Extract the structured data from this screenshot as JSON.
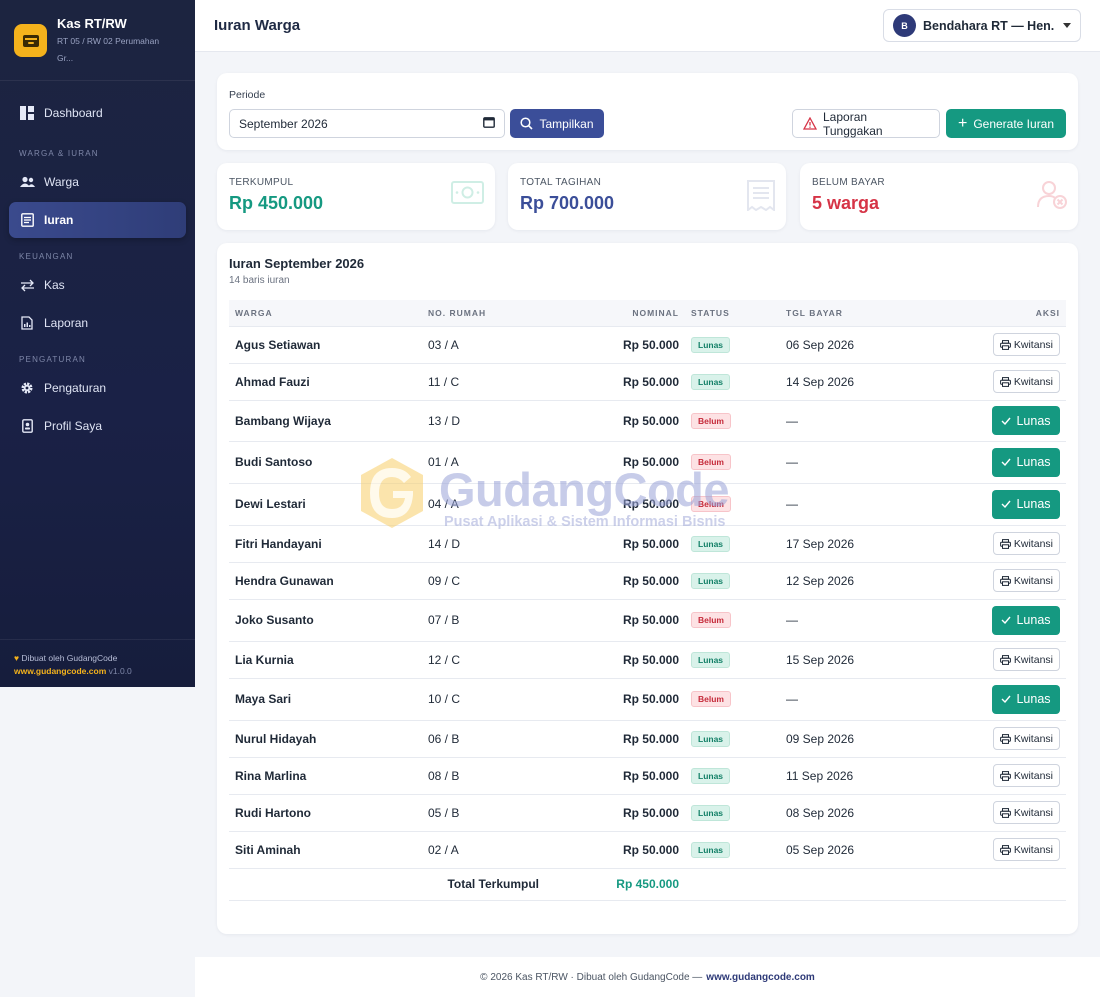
{
  "sidebar": {
    "brand_title": "Kas RT/RW",
    "brand_sub": "RT 05 / RW 02 Perumahan Gr...",
    "dashboard": "Dashboard",
    "section_warga": "WARGA & IURAN",
    "warga": "Warga",
    "iuran": "Iuran",
    "section_keuangan": "KEUANGAN",
    "kas": "Kas",
    "laporan": "Laporan",
    "section_pengaturan": "PENGATURAN",
    "pengaturan": "Pengaturan",
    "profil": "Profil Saya",
    "foot_made": "Dibuat oleh GudangCode",
    "foot_link": "www.gudangcode.com",
    "foot_version": "v1.0.0"
  },
  "header": {
    "title": "Iuran Warga",
    "user_initial": "B",
    "user_name": "Bendahara RT — Hen..."
  },
  "filter": {
    "label": "Periode",
    "value": "September 2026",
    "tampilkan": "Tampilkan",
    "laporan_tunggakan": "Laporan Tunggakan",
    "generate": "Generate Iuran"
  },
  "stats": {
    "terkumpul_label": "TERKUMPUL",
    "terkumpul_value": "Rp 450.000",
    "tagihan_label": "TOTAL TAGIHAN",
    "tagihan_value": "Rp 700.000",
    "belum_label": "BELUM BAYAR",
    "belum_value": "5 warga"
  },
  "colors": {
    "accent": "#159981",
    "primary": "#3b4e99",
    "danger": "#d63447",
    "brand": "#f4b21c"
  },
  "table": {
    "title": "Iuran September 2026",
    "subtitle": "14 baris iuran",
    "headers": [
      "WARGA",
      "NO. RUMAH",
      "NOMINAL",
      "STATUS",
      "TGL BAYAR",
      "AKSI"
    ],
    "rows": [
      {
        "warga": "Agus Setiawan",
        "rumah": "03 / A",
        "nominal": "Rp 50.000",
        "status": "Lunas",
        "tgl": "06 Sep 2026",
        "aksi": "Kwitansi"
      },
      {
        "warga": "Ahmad Fauzi",
        "rumah": "11 / C",
        "nominal": "Rp 50.000",
        "status": "Lunas",
        "tgl": "14 Sep 2026",
        "aksi": "Kwitansi"
      },
      {
        "warga": "Bambang Wijaya",
        "rumah": "13 / D",
        "nominal": "Rp 50.000",
        "status": "Belum",
        "tgl": "—",
        "aksi": "Lunas"
      },
      {
        "warga": "Budi Santoso",
        "rumah": "01 / A",
        "nominal": "Rp 50.000",
        "status": "Belum",
        "tgl": "—",
        "aksi": "Lunas"
      },
      {
        "warga": "Dewi Lestari",
        "rumah": "04 / A",
        "nominal": "Rp 50.000",
        "status": "Belum",
        "tgl": "—",
        "aksi": "Lunas"
      },
      {
        "warga": "Fitri Handayani",
        "rumah": "14 / D",
        "nominal": "Rp 50.000",
        "status": "Lunas",
        "tgl": "17 Sep 2026",
        "aksi": "Kwitansi"
      },
      {
        "warga": "Hendra Gunawan",
        "rumah": "09 / C",
        "nominal": "Rp 50.000",
        "status": "Lunas",
        "tgl": "12 Sep 2026",
        "aksi": "Kwitansi"
      },
      {
        "warga": "Joko Susanto",
        "rumah": "07 / B",
        "nominal": "Rp 50.000",
        "status": "Belum",
        "tgl": "—",
        "aksi": "Lunas"
      },
      {
        "warga": "Lia Kurnia",
        "rumah": "12 / C",
        "nominal": "Rp 50.000",
        "status": "Lunas",
        "tgl": "15 Sep 2026",
        "aksi": "Kwitansi"
      },
      {
        "warga": "Maya Sari",
        "rumah": "10 / C",
        "nominal": "Rp 50.000",
        "status": "Belum",
        "tgl": "—",
        "aksi": "Lunas"
      },
      {
        "warga": "Nurul Hidayah",
        "rumah": "06 / B",
        "nominal": "Rp 50.000",
        "status": "Lunas",
        "tgl": "09 Sep 2026",
        "aksi": "Kwitansi"
      },
      {
        "warga": "Rina Marlina",
        "rumah": "08 / B",
        "nominal": "Rp 50.000",
        "status": "Lunas",
        "tgl": "11 Sep 2026",
        "aksi": "Kwitansi"
      },
      {
        "warga": "Rudi Hartono",
        "rumah": "05 / B",
        "nominal": "Rp 50.000",
        "status": "Lunas",
        "tgl": "08 Sep 2026",
        "aksi": "Kwitansi"
      },
      {
        "warga": "Siti Aminah",
        "rumah": "02 / A",
        "nominal": "Rp 50.000",
        "status": "Lunas",
        "tgl": "05 Sep 2026",
        "aksi": "Kwitansi"
      }
    ],
    "total_label": "Total Terkumpul",
    "total_value": "Rp 450.000"
  },
  "watermark": {
    "name": "GudangCode",
    "tagline": "Pusat Aplikasi & Sistem Informasi Bisnis"
  },
  "footer": {
    "text": "© 2026 Kas RT/RW · Dibuat oleh GudangCode —",
    "link": "www.gudangcode.com"
  }
}
